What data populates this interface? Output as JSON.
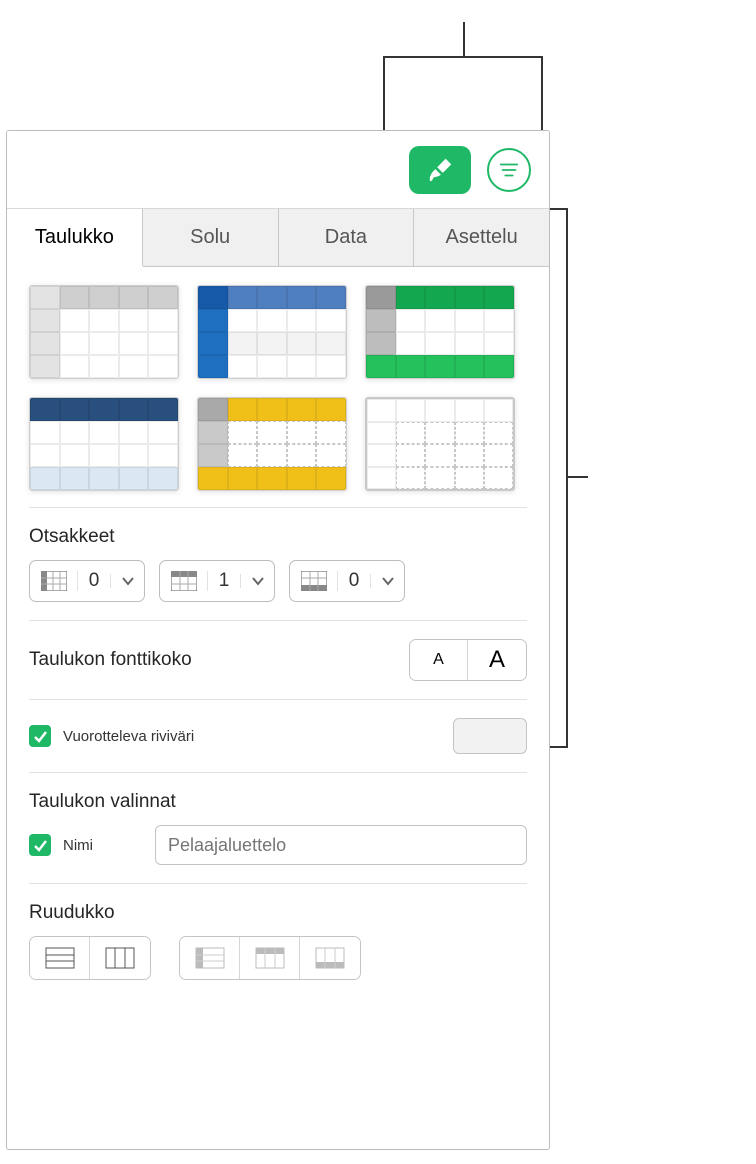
{
  "tabs": {
    "taulukko": "Taulukko",
    "solu": "Solu",
    "data": "Data",
    "asettelu": "Asettelu",
    "active": "taulukko"
  },
  "sections": {
    "headers_title": "Otsakkeet",
    "font_size_title": "Taulukon fonttikoko",
    "alt_row_label": "Vuorotteleva riviväri",
    "options_title": "Taulukon valinnat",
    "name_label": "Nimi",
    "name_placeholder": "Pelaajaluettelo",
    "grid_title": "Ruudukko"
  },
  "header_controls": {
    "header_cols": "0",
    "header_rows": "1",
    "footer_rows": "0"
  },
  "checks": {
    "alt_row": true,
    "name": true
  }
}
